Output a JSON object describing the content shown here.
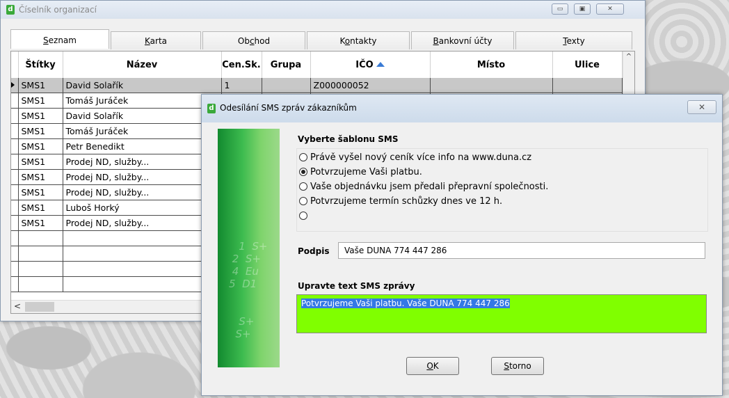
{
  "main_window": {
    "title": "Číselník organizací",
    "controls": [
      "▭",
      "▣",
      "✕"
    ]
  },
  "tabs": [
    {
      "pre": "",
      "u": "S",
      "post": "eznam"
    },
    {
      "pre": "",
      "u": "K",
      "post": "arta"
    },
    {
      "pre": "Ob",
      "u": "c",
      "post": "hod"
    },
    {
      "pre": "K",
      "u": "o",
      "post": "ntakty"
    },
    {
      "pre": "",
      "u": "B",
      "post": "ankovní účty"
    },
    {
      "pre": "",
      "u": "T",
      "post": "exty"
    }
  ],
  "grid": {
    "columns": [
      "Štítky",
      "Název",
      "Cen.Sk.",
      "Grupa",
      "IČO",
      "Místo",
      "Ulice"
    ],
    "rows": [
      [
        "SMS1",
        "David Solařík",
        "1",
        "",
        "Z000000052",
        "",
        ""
      ],
      [
        "SMS1",
        "Tomáš  Juráček",
        "",
        "",
        "",
        "",
        ""
      ],
      [
        "SMS1",
        "David Solařík",
        "",
        "",
        "",
        "",
        ""
      ],
      [
        "SMS1",
        "Tomáš  Juráček",
        "",
        "",
        "",
        "",
        ""
      ],
      [
        "SMS1",
        "Petr Benedikt",
        "",
        "",
        "",
        "",
        ""
      ],
      [
        "SMS1",
        "Prodej ND, služby...",
        "",
        "",
        "",
        "",
        ""
      ],
      [
        "SMS1",
        "Prodej ND, služby...",
        "",
        "",
        "",
        "",
        ""
      ],
      [
        "SMS1",
        "Prodej ND, služby...",
        "",
        "",
        "",
        "",
        ""
      ],
      [
        "SMS1",
        "Luboš Horký",
        "",
        "",
        "",
        "",
        ""
      ],
      [
        "SMS1",
        "Prodej ND, služby...",
        "",
        "",
        "",
        "",
        ""
      ],
      [
        "",
        "",
        "",
        "",
        "",
        "",
        ""
      ],
      [
        "",
        "",
        "",
        "",
        "",
        "",
        ""
      ],
      [
        "",
        "",
        "",
        "",
        "",
        "",
        ""
      ],
      [
        "",
        "",
        "",
        "",
        "",
        "",
        ""
      ]
    ]
  },
  "dialog": {
    "title": "Odesílání SMS zpráv zákazníkům",
    "close": "✕",
    "template_label": "Vyberte šablonu SMS",
    "templates": [
      {
        "text": "Právě vyšel nový ceník více info na www.duna.cz",
        "selected": false
      },
      {
        "text": "Potvrzujeme Vaši platbu.",
        "selected": true
      },
      {
        "text": "Vaše objednávku jsem předali přepravní společnosti.",
        "selected": false
      },
      {
        "text": "Potvrzujeme termín schůzky dnes ve 12 h.",
        "selected": false
      },
      {
        "text": "",
        "selected": false
      }
    ],
    "signature_label": "Podpis",
    "signature_value": "Vaše DUNA 774 447 286",
    "edit_label": "Upravte text SMS zprávy",
    "sms_text": "Potvrzujeme Vaši platbu. Vaše DUNA 774 447 286",
    "ok": {
      "u": "O",
      "post": "K"
    },
    "cancel": {
      "u": "S",
      "post": "torno"
    }
  },
  "colors": {
    "sms_bg": "#80ff00",
    "highlight": "#3478e5",
    "accent": "#3aa93a"
  }
}
